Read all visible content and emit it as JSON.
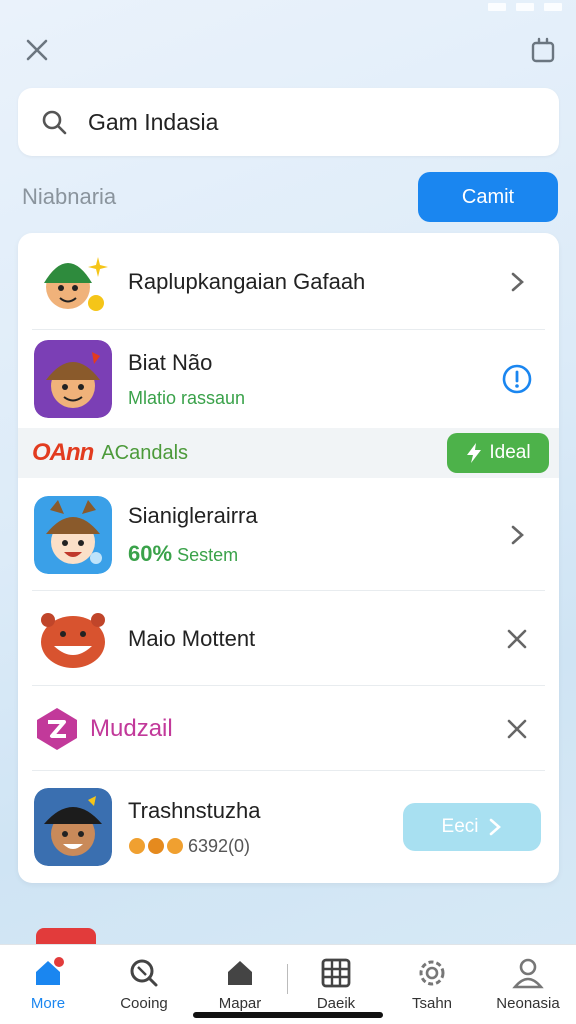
{
  "search": {
    "value": "Gam Indasia"
  },
  "section": {
    "title": "Niabnaria",
    "button_label": "Camit"
  },
  "items": [
    {
      "title": "Raplupkangaian Gafaah",
      "subtitle": "",
      "action_icon": "chevron-right-icon"
    },
    {
      "title": "Biat Não",
      "subtitle": "Mlatio rassaun",
      "action_icon": "info-icon"
    },
    {
      "title": "Sianiglerairra",
      "subtitle_value": "60%",
      "subtitle": "Sestem",
      "action_icon": "chevron-right-icon"
    },
    {
      "title": "Maio Mottent",
      "subtitle": "",
      "action_icon": "close-icon"
    },
    {
      "title": "Mudzail",
      "subtitle": "",
      "action_icon": "close-icon"
    },
    {
      "title": "Trashnstuzha",
      "subtitle": "6392(0)",
      "button_label": "Eeci"
    }
  ],
  "promo": {
    "logo": "OAnn",
    "text": "ACandals",
    "button_label": "Ideal"
  },
  "nav": [
    {
      "label": "More",
      "icon": "home-icon",
      "active": true
    },
    {
      "label": "Cooing",
      "icon": "search-icon"
    },
    {
      "label": "Mapar",
      "icon": "house-icon"
    },
    {
      "label": "Daeik",
      "icon": "grid-icon"
    },
    {
      "label": "Tsahn",
      "icon": "gear-icon"
    },
    {
      "label": "Neonasia",
      "icon": "user-icon"
    }
  ],
  "colors": {
    "accent": "#1a86f0",
    "green": "#3aa24a",
    "promo_button": "#4db24a"
  }
}
